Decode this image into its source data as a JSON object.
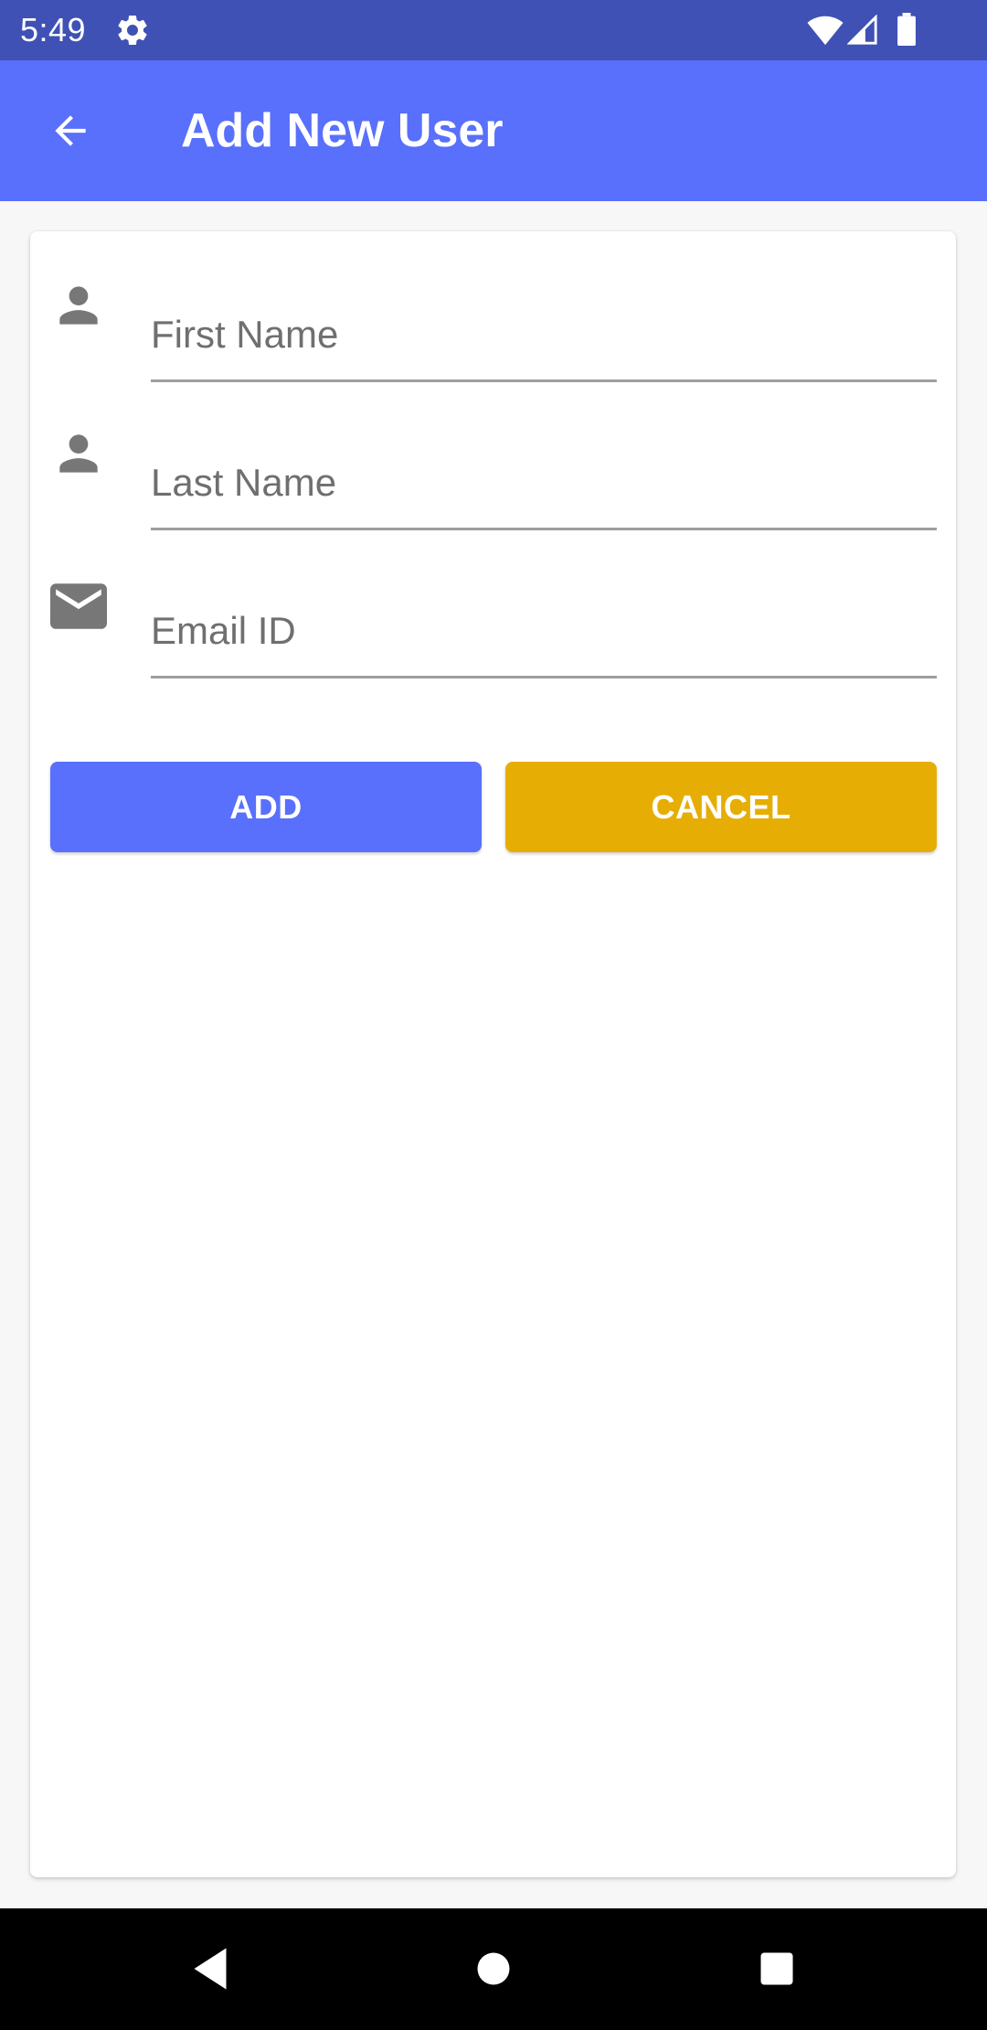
{
  "status_bar": {
    "time": "5:49",
    "icons": [
      "gear-icon",
      "wifi-icon",
      "signal-icon",
      "battery-icon"
    ]
  },
  "app_bar": {
    "title": "Add New User",
    "back_icon": "arrow-back-icon",
    "color": "#5870fb"
  },
  "form": {
    "first_name": {
      "placeholder": "First Name",
      "value": "",
      "icon": "person-icon"
    },
    "last_name": {
      "placeholder": "Last Name",
      "value": "",
      "icon": "person-icon"
    },
    "email": {
      "placeholder": "Email ID",
      "value": "",
      "icon": "mail-icon"
    }
  },
  "actions": {
    "add_label": "ADD",
    "add_color": "#5870fb",
    "cancel_label": "CANCEL",
    "cancel_color": "#e6ae05"
  },
  "nav_bar": {
    "icons": [
      "nav-back-icon",
      "nav-home-icon",
      "nav-recents-icon"
    ]
  },
  "colors": {
    "status_bar": "#3f51b5",
    "background": "#f7f7f7",
    "icon_gray": "#777777"
  }
}
